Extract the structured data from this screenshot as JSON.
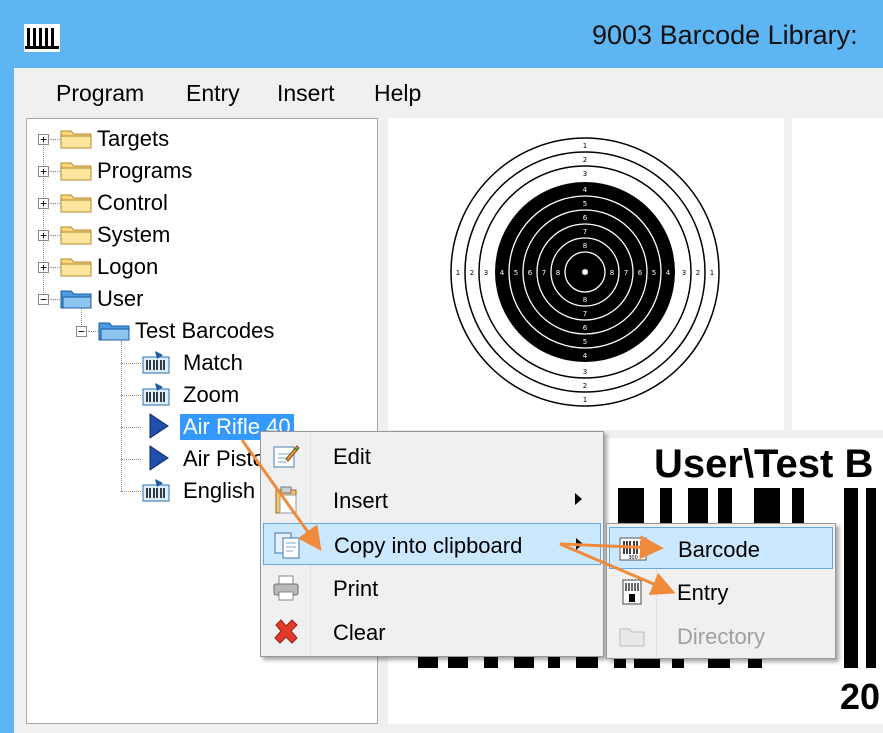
{
  "window": {
    "title": "9003 Barcode Library:"
  },
  "menu": [
    "Program",
    "Entry",
    "Insert",
    "Help"
  ],
  "tree": {
    "roots": [
      {
        "label": "Targets"
      },
      {
        "label": "Programs"
      },
      {
        "label": "Control"
      },
      {
        "label": "System"
      },
      {
        "label": "Logon"
      },
      {
        "label": "User"
      }
    ],
    "user_child": "Test Barcodes",
    "leaves": [
      {
        "label": "Match",
        "icon": "barcode-doc-icon"
      },
      {
        "label": "Zoom",
        "icon": "barcode-doc-icon"
      },
      {
        "label": "Air Rifle 40",
        "icon": "play-marker-icon"
      },
      {
        "label": "Air Pisto",
        "icon": "play-marker-icon"
      },
      {
        "label": "English",
        "icon": "barcode-doc-icon"
      }
    ]
  },
  "target": {
    "numbers_vertical": [
      "1",
      "2",
      "3",
      "4",
      "5",
      "6",
      "7",
      "8",
      "9"
    ],
    "numbers_horizontal": [
      "1",
      "2",
      "3",
      "4",
      "5",
      "6",
      "7",
      "8"
    ]
  },
  "barcode_preview": {
    "heading": "User\\Test B",
    "footer": "20"
  },
  "context_menu": {
    "items": [
      {
        "label": "Edit",
        "icon": "edit-icon"
      },
      {
        "label": "Insert",
        "icon": "clipboard-icon",
        "submenu": true
      },
      {
        "label": "Copy into clipboard",
        "icon": "copy-icon",
        "submenu": true
      },
      {
        "label": "Print",
        "icon": "printer-icon"
      },
      {
        "label": "Clear",
        "icon": "red-x-icon"
      }
    ]
  },
  "submenu": {
    "items": [
      {
        "label": "Barcode",
        "icon": "barcode-icon"
      },
      {
        "label": "Entry",
        "icon": "entry-icon"
      },
      {
        "label": "Directory",
        "icon": "folder-icon",
        "disabled": true
      }
    ]
  },
  "colors": {
    "selection": "#3399ff",
    "menu_highlight": "#cce8ff",
    "annotation_arrow": "#f08a3c",
    "window_frame": "#5eb5f3"
  }
}
